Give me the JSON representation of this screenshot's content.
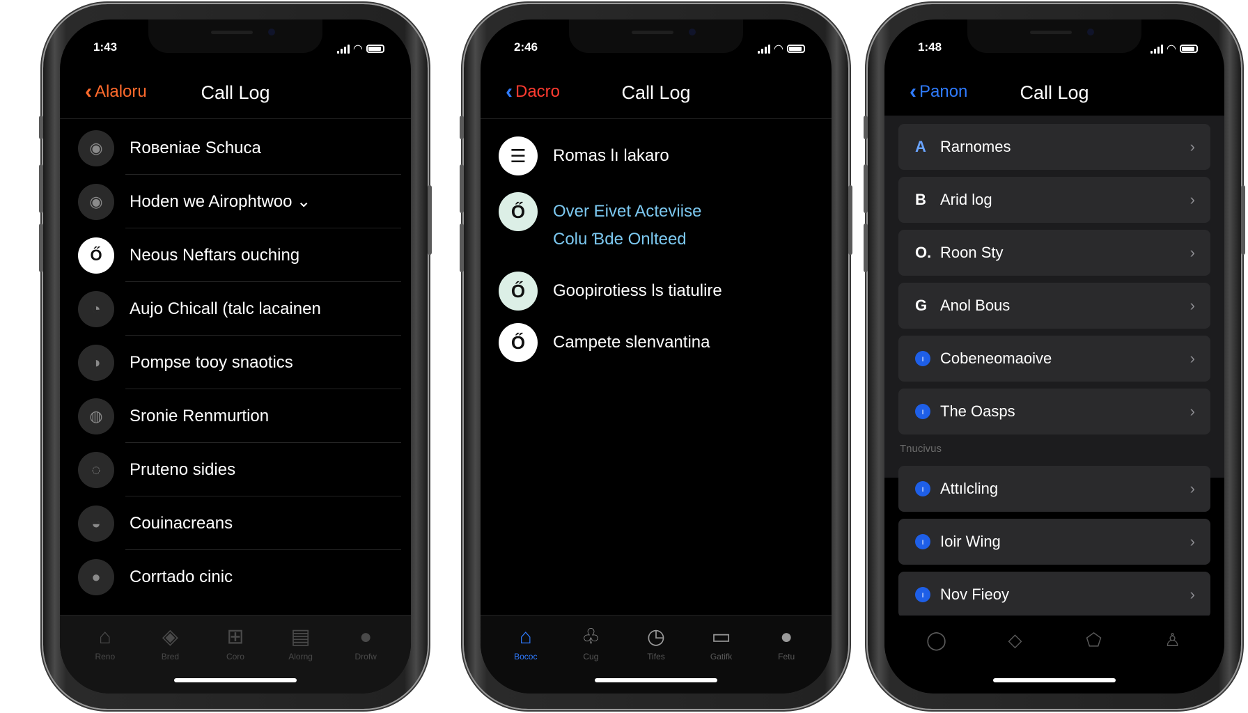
{
  "colors": {
    "orange": "#ff6a2c",
    "blue": "#2f7bff",
    "red": "#ff3b30",
    "link_blue": "#7cc8f0",
    "cell_bg": "#2a2a2c"
  },
  "phone1": {
    "time": "1:43",
    "back_label": "Alaloru",
    "title": "Call Log",
    "items": [
      {
        "label": "Roʙeniae Schuca",
        "icon": "person-icon",
        "glyph": "◉"
      },
      {
        "label": "Hoden we Airophtwoo ⌄",
        "icon": "person-icon",
        "glyph": "◉"
      },
      {
        "label": "Neous Neftars ouching",
        "icon": "bell-icon",
        "glyph": "Ő"
      },
      {
        "label": "Aujo Chicall (talc lacainen",
        "icon": "person-icon",
        "glyph": "◔"
      },
      {
        "label": "Pompse tooy snaotics",
        "icon": "person-icon",
        "glyph": "◑"
      },
      {
        "label": "Sronie Renmurtion",
        "icon": "person-icon",
        "glyph": "◍"
      },
      {
        "label": "Pruteno sidies",
        "icon": "person-icon",
        "glyph": "◌"
      },
      {
        "label": "Couinacreans",
        "icon": "person-icon",
        "glyph": "◒"
      },
      {
        "label": "Corrtado cinic",
        "icon": "person-icon",
        "glyph": "●"
      }
    ],
    "tabs": [
      {
        "label": "Reno",
        "icon": "home-icon",
        "glyph": "⌂"
      },
      {
        "label": "Bred",
        "icon": "diamond-icon",
        "glyph": "◈"
      },
      {
        "label": "Coro",
        "icon": "grid-icon",
        "glyph": "⊞"
      },
      {
        "label": "Alorng",
        "icon": "book-icon",
        "glyph": "▤"
      },
      {
        "label": "Drofw",
        "icon": "profile-icon",
        "glyph": "●"
      }
    ]
  },
  "phone2": {
    "time": "2:46",
    "back_label": "Dacro",
    "title": "Call Log",
    "items": [
      {
        "lines": [
          "Romas lı lakaro"
        ],
        "icon": "menu-icon",
        "glyph": "☰",
        "style": "white",
        "accent": false
      },
      {
        "lines": [
          "Over Eivet Acteviise",
          "Colu Ɓde Onlteed"
        ],
        "icon": "timer-icon",
        "glyph": "Ő",
        "style": "mint",
        "accent": true
      },
      {
        "lines": [
          "Goopirotiess ls tiatulire"
        ],
        "icon": "timer-icon",
        "glyph": "Ő",
        "style": "mint",
        "accent": false
      },
      {
        "lines": [
          "Campete slenvantina"
        ],
        "icon": "timer-icon",
        "glyph": "Ő",
        "style": "white",
        "accent": false
      }
    ],
    "tabs": [
      {
        "label": "Bococ",
        "icon": "home-icon",
        "glyph": "⌂",
        "active": true
      },
      {
        "label": "Cug",
        "icon": "bag-icon",
        "glyph": "♧",
        "active": false
      },
      {
        "label": "Tifes",
        "icon": "clock-icon",
        "glyph": "◷",
        "active": false
      },
      {
        "label": "Gatifk",
        "icon": "document-icon",
        "glyph": "▭",
        "active": false
      },
      {
        "label": "Fetu",
        "icon": "profile-icon",
        "glyph": "●",
        "active": false
      }
    ]
  },
  "phone3": {
    "time": "1:48",
    "back_label": "Panon",
    "title": "Call Log",
    "group1": [
      {
        "lead": "A",
        "label": "Rarnomes",
        "type": "letter-a"
      },
      {
        "lead": "B",
        "label": "Arid log",
        "type": "letter"
      },
      {
        "lead": "O.",
        "label": "Roon Sty",
        "type": "letter"
      },
      {
        "lead": "G",
        "label": "Anol Bous",
        "type": "letter"
      },
      {
        "lead": "",
        "label": "Cobeneomaoive",
        "type": "dot"
      },
      {
        "lead": "",
        "label": "The Oasps",
        "type": "dot"
      }
    ],
    "section_header": "Tnucivus",
    "group2": [
      {
        "label": "Attılcling"
      },
      {
        "label": "Ioir Wing"
      },
      {
        "label": "Nov Fieoy"
      }
    ],
    "tabs": [
      {
        "icon": "circle-icon",
        "glyph": "◯"
      },
      {
        "icon": "diamond-icon",
        "glyph": "◇"
      },
      {
        "icon": "pentagon-icon",
        "glyph": "⬠"
      },
      {
        "icon": "profile-icon",
        "glyph": "♙"
      }
    ]
  }
}
